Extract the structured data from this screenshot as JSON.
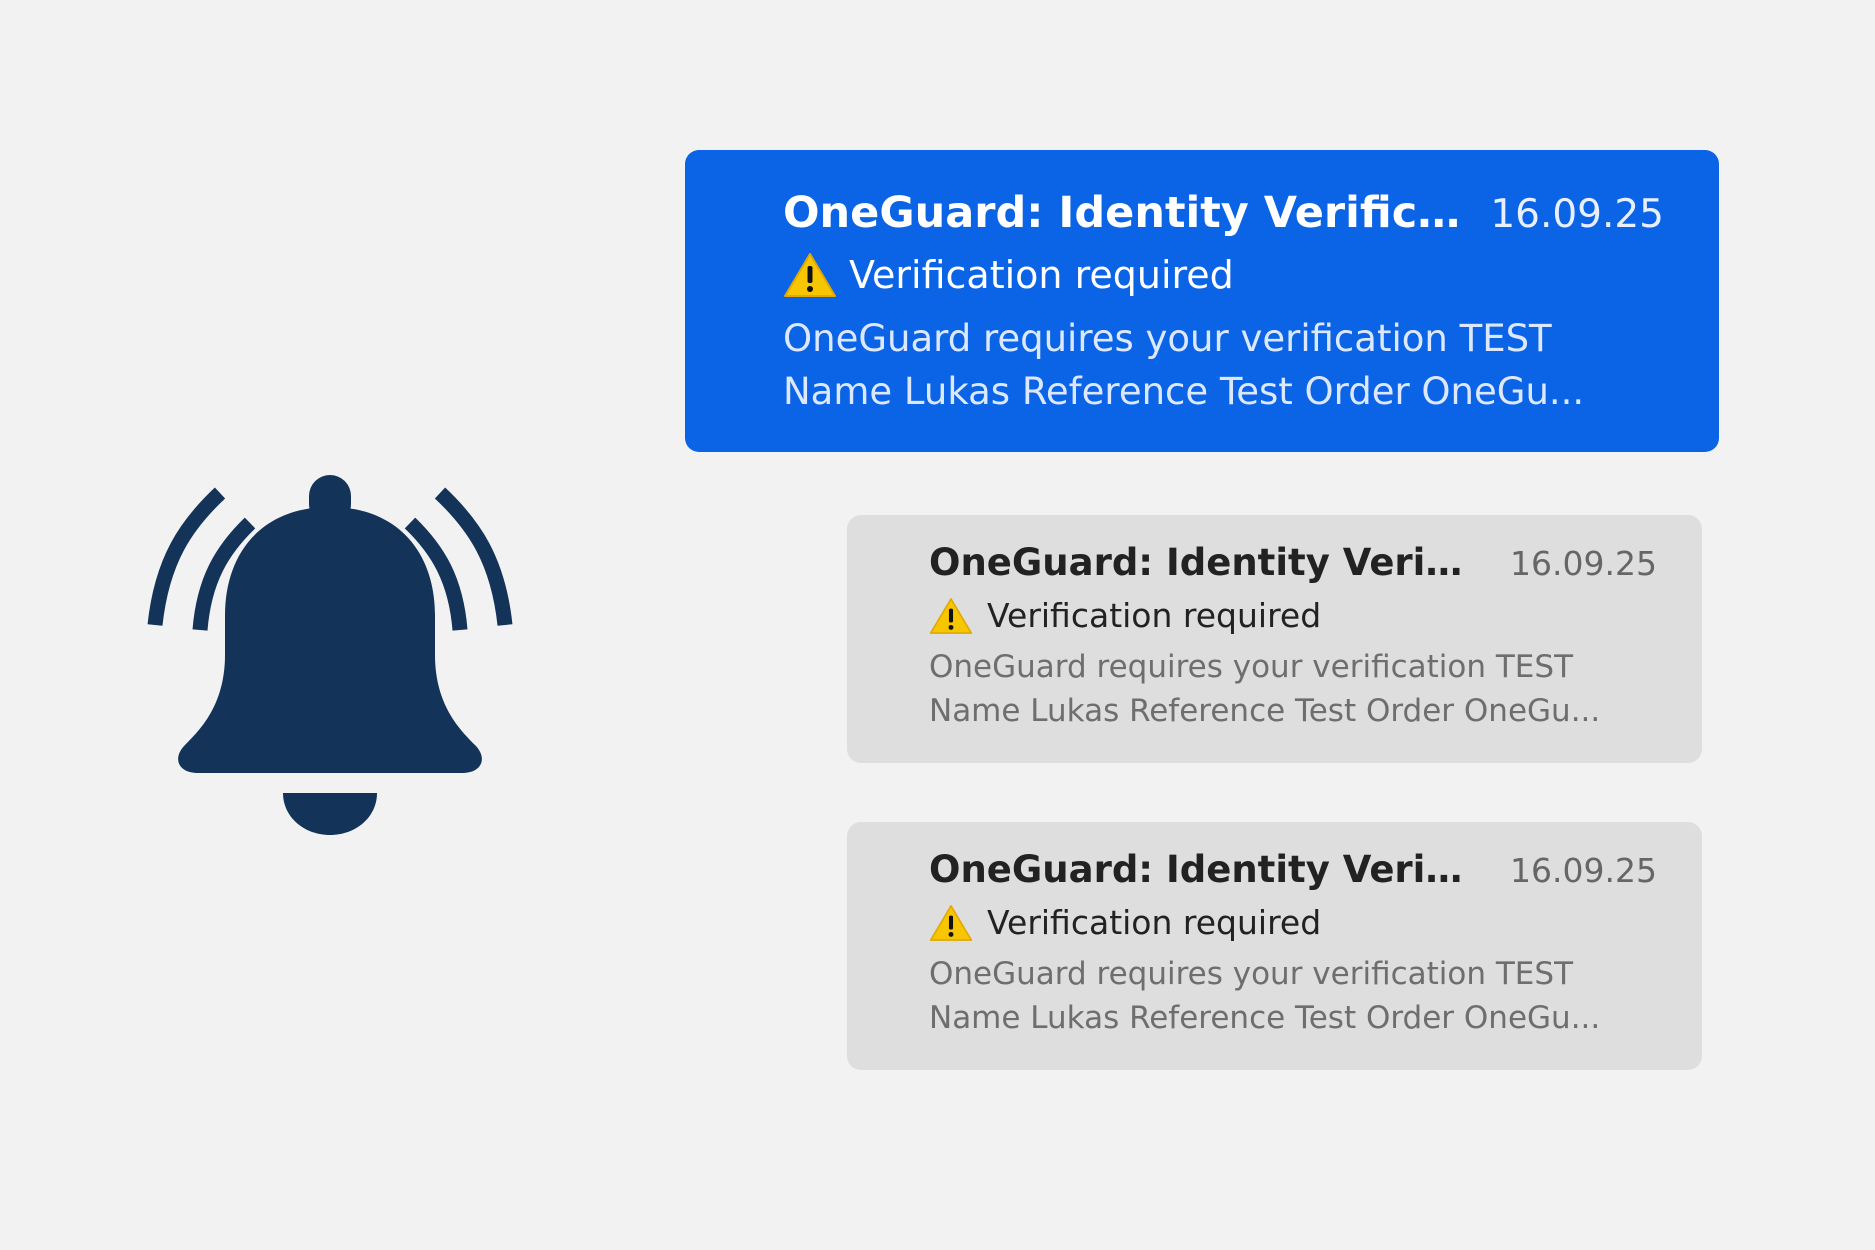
{
  "bell": {
    "icon": "bell-ringing-icon",
    "color": "#133358"
  },
  "notifications": [
    {
      "state": "selected",
      "title": "OneGuard: Identity Verific...",
      "date": "16.09.25",
      "icon": "warning-icon",
      "subtitle": "Verification required",
      "body_line1": "OneGuard requires your verification TEST",
      "body_line2": "Name Lukas Reference Test Order OneGu..."
    },
    {
      "state": "normal",
      "title": "OneGuard: Identity Verific...",
      "date": "16.09.25",
      "icon": "warning-icon",
      "subtitle": "Verification required",
      "body_line1": "OneGuard requires your verification TEST",
      "body_line2": "Name Lukas Reference Test Order OneGu..."
    },
    {
      "state": "normal",
      "title": "OneGuard: Identity Verific...",
      "date": "16.09.25",
      "icon": "warning-icon",
      "subtitle": "Verification required",
      "body_line1": "OneGuard requires your verification TEST",
      "body_line2": "Name Lukas Reference Test Order OneGu..."
    }
  ],
  "colors": {
    "background": "#f2f2f2",
    "selected_bg": "#0b63e5",
    "normal_bg": "#dedede",
    "warning_yellow": "#f7c600"
  }
}
